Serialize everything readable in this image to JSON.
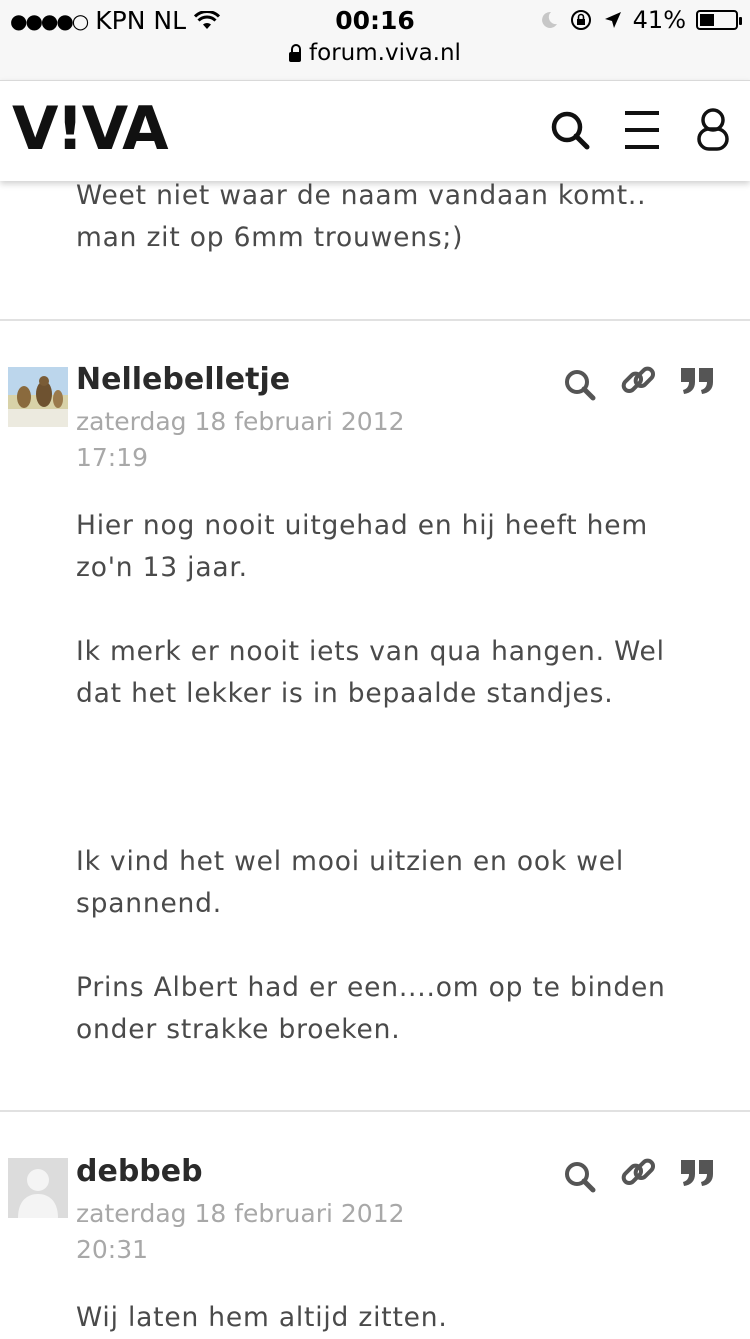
{
  "statusbar": {
    "carrier": "KPN NL",
    "time": "00:16",
    "battery_percent": "41%",
    "battery_level": 0.41,
    "url": "forum.viva.nl"
  },
  "header": {
    "logo": "V!VA"
  },
  "posts": [
    {
      "partial": true,
      "paragraphs": [
        "Weet niet waar de naam vandaan komt.. man zit op 6mm trouwens;)"
      ]
    },
    {
      "username": "Nellebelletje",
      "date": "zaterdag 18 februari 2012",
      "time": "17:19",
      "paragraphs": [
        "Hier nog nooit uitgehad en hij heeft hem zo'n 13 jaar.",
        "Ik merk er nooit iets van qua hangen. Wel dat het lekker is in bepaalde standjes.",
        "Ik vind het wel mooi uitzien en ook wel spannend.",
        "Prins Albert had er een....om op te binden onder strakke broeken."
      ]
    },
    {
      "username": "debbeb",
      "date": "zaterdag 18 februari 2012",
      "time": "20:31",
      "paragraphs": [
        "Wij laten hem altijd zitten."
      ]
    }
  ]
}
